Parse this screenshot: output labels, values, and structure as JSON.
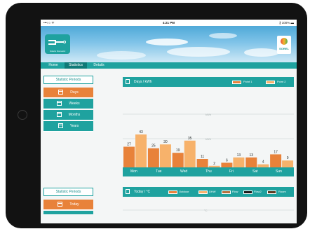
{
  "status_bar": {
    "carrier": "•••○○ ᯤ",
    "time": "4:21 PM",
    "battery": "∦ 100% ▬"
  },
  "app_logo": {
    "subtitle": "Solaris Domestic"
  },
  "brand_logo": {
    "text": "SOREL"
  },
  "tabs": [
    {
      "label": "Home",
      "active": false
    },
    {
      "label": "Statistics",
      "active": true
    },
    {
      "label": "Details",
      "active": false
    }
  ],
  "sidebar": {
    "statistic_periods_header": "Statistic Periods",
    "period_items": [
      {
        "label": "Days",
        "active": true,
        "icon": "calendar-icon"
      },
      {
        "label": "Weeks",
        "active": false,
        "icon": "calendar-icon"
      },
      {
        "label": "Months",
        "active": false,
        "icon": "calendar-icon"
      },
      {
        "label": "Years",
        "active": false,
        "icon": "calendar-icon"
      }
    ],
    "statistic_periods_header_2": "Statistic Periods",
    "today_item": {
      "label": "Today",
      "active": true,
      "icon": "calendar-icon"
    }
  },
  "energy_chart": {
    "title": "Days / kWh",
    "legend": [
      {
        "label": "Point 1",
        "color": "#e8823a"
      },
      {
        "label": "Point 2",
        "color": "#f7b26b"
      }
    ],
    "gridline_labels": [
      "kWh",
      "kWh"
    ]
  },
  "temperature_panel": {
    "title": "Today / °C",
    "legend": [
      {
        "label": "Outdoor",
        "color": "#e8823a"
      },
      {
        "label": "DHW",
        "color": "#f7b26b"
      },
      {
        "label": "Flow",
        "color": "#b4713c"
      },
      {
        "label": "Flow2",
        "color": "#1a1a1a"
      },
      {
        "label": "Room",
        "color": "#5b3a1e"
      }
    ],
    "gridline_label": "°C"
  },
  "chart_data": {
    "type": "bar",
    "categories": [
      "Mon",
      "Tue",
      "Wed",
      "Thu",
      "Fri",
      "Sat",
      "Sun"
    ],
    "series": [
      {
        "name": "Point 1",
        "values": [
          27,
          25,
          19,
          11,
          6,
          13,
          17
        ],
        "color": "#e8823a"
      },
      {
        "name": "Point 2",
        "values": [
          43,
          30,
          35,
          2,
          13,
          4,
          9
        ],
        "color": "#f7b26b"
      }
    ],
    "ylim": [
      0,
      65
    ],
    "grid": true,
    "legend": "top-right"
  }
}
